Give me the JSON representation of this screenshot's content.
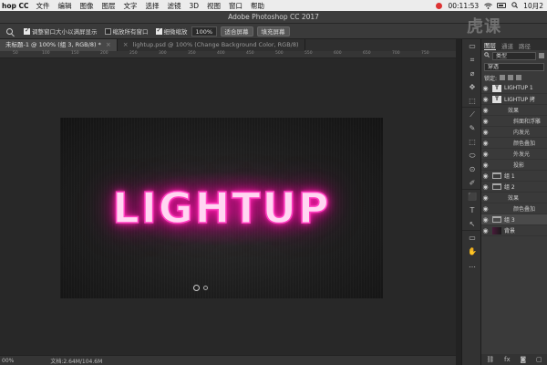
{
  "menubar": {
    "app_name": "hop CC",
    "menu_items": [
      "文件",
      "编辑",
      "图像",
      "图层",
      "文字",
      "选择",
      "滤镜",
      "3D",
      "视图",
      "窗口",
      "帮助"
    ],
    "time": "00:11:53",
    "date_partial": "10月2"
  },
  "titlebar": {
    "title": "Adobe Photoshop CC 2017"
  },
  "options": {
    "check1_label": "调整窗口大小以满屏显示",
    "check2_label": "缩放所有窗口",
    "check3_label": "细微缩放",
    "zoom_value": "100%",
    "fit_button": "适合屏幕",
    "fill_button": "填充屏幕"
  },
  "tabs": [
    {
      "label": "未标题-1 @ 100% (组 3, RGB/8) *",
      "active": true
    },
    {
      "label": "lightup.psd @ 100% (Change Background Color, RGB/8)",
      "active": false
    }
  ],
  "ruler_ticks": [
    "50",
    "100",
    "150",
    "200",
    "250",
    "300",
    "350",
    "400",
    "450",
    "500",
    "550",
    "600",
    "650",
    "700",
    "750"
  ],
  "canvas": {
    "text": "LIGHTUP",
    "glow_color": "#ff1aa8"
  },
  "status": {
    "zoom": "00%",
    "doc_info": "文档:2.64M/104.6M"
  },
  "tools": [
    "▭",
    "⌗",
    "⌀",
    "✥",
    "⬚",
    "⟋",
    "✎",
    "⬚",
    "⬭",
    "⊙",
    "✐",
    "⬛",
    "T",
    "↖",
    "▭",
    "✋",
    "…"
  ],
  "panel": {
    "tabs": [
      "图层",
      "通道",
      "路径"
    ],
    "kind_filter": "类型",
    "blend_mode": "穿透",
    "lock_label": "锁定:",
    "layers": [
      {
        "kind": "text",
        "name": "LIGHTUP 1",
        "indent": 0,
        "eye": true
      },
      {
        "kind": "text",
        "name": "LIGHTUP 拷",
        "indent": 0,
        "eye": true
      },
      {
        "kind": "fx",
        "name": "效果",
        "indent": 1,
        "eye": true
      },
      {
        "kind": "fx",
        "name": "斜面和浮雕",
        "indent": 2,
        "eye": true
      },
      {
        "kind": "fx",
        "name": "内发光",
        "indent": 2,
        "eye": true
      },
      {
        "kind": "fx",
        "name": "颜色叠加",
        "indent": 2,
        "eye": true
      },
      {
        "kind": "fx",
        "name": "外发光",
        "indent": 2,
        "eye": true
      },
      {
        "kind": "fx",
        "name": "投影",
        "indent": 2,
        "eye": true
      },
      {
        "kind": "group",
        "name": "组 1",
        "indent": 0,
        "eye": true
      },
      {
        "kind": "group",
        "name": "组 2",
        "indent": 0,
        "eye": true
      },
      {
        "kind": "fx",
        "name": "效果",
        "indent": 1,
        "eye": true
      },
      {
        "kind": "fx",
        "name": "颜色叠加",
        "indent": 2,
        "eye": true
      },
      {
        "kind": "group",
        "name": "组 3",
        "indent": 0,
        "eye": true,
        "selected": true
      },
      {
        "kind": "image",
        "name": "背景",
        "indent": 0,
        "eye": true
      }
    ]
  },
  "watermark": "虎课"
}
